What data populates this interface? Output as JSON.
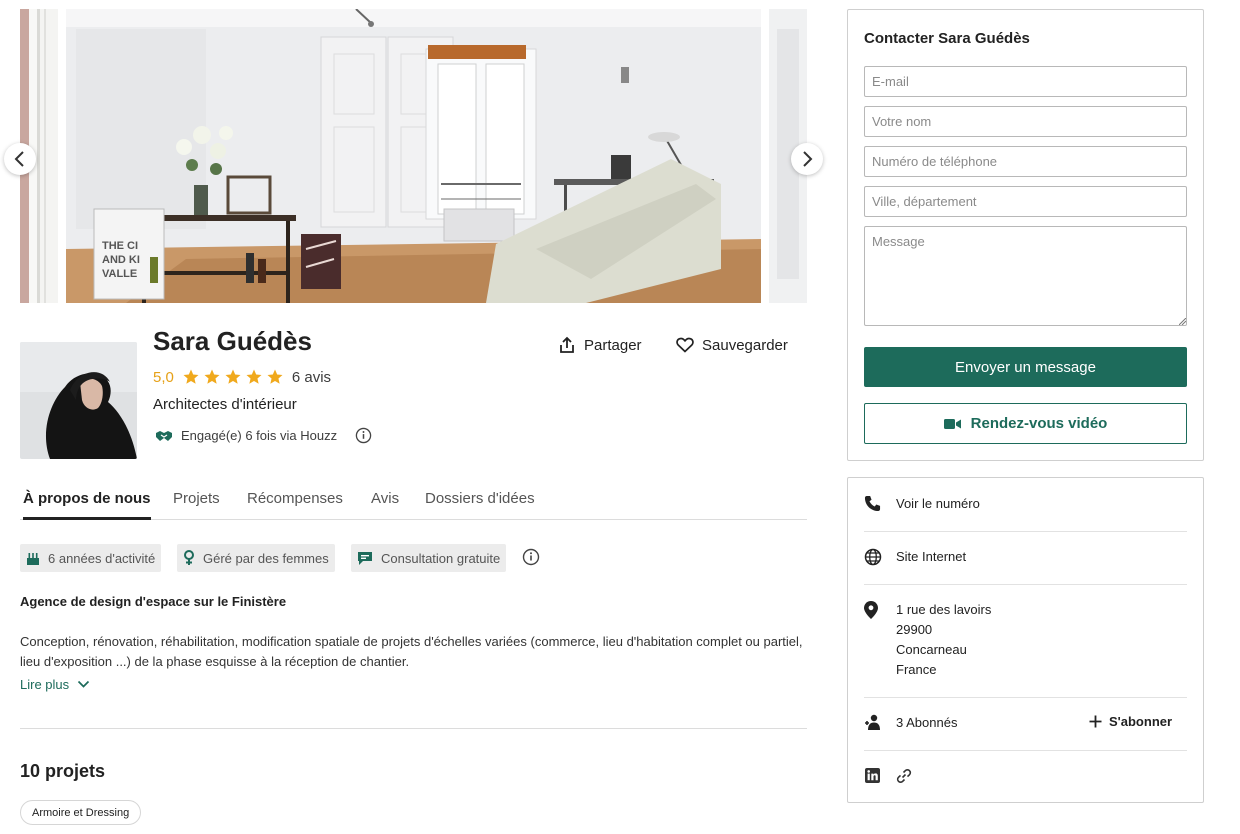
{
  "gallery": {
    "prev_icon": "chevron-left-icon",
    "next_icon": "chevron-right-icon"
  },
  "profile": {
    "name": "Sara Guédès",
    "rating": "5,0",
    "stars": 5,
    "reviews": "6 avis",
    "category": "Architectes d'intérieur",
    "engaged": "Engagé(e) 6 fois via Houzz",
    "share_label": "Partager",
    "save_label": "Sauvegarder"
  },
  "tabs": [
    {
      "label": "À propos de nous",
      "active": true
    },
    {
      "label": "Projets",
      "active": false
    },
    {
      "label": "Récompenses",
      "active": false
    },
    {
      "label": "Avis",
      "active": false
    },
    {
      "label": "Dossiers d'idées",
      "active": false
    }
  ],
  "badges": [
    {
      "label": "6 années d'activité",
      "icon": "cake-icon"
    },
    {
      "label": "Géré par des femmes",
      "icon": "female-icon"
    },
    {
      "label": "Consultation gratuite",
      "icon": "chat-icon"
    }
  ],
  "about": {
    "title": "Agence de design d'espace sur le Finistère",
    "text": "Conception, rénovation, réhabilitation, modification spatiale de projets d'échelles variées (commerce, lieu d'habitation complet ou partiel, lieu d'exposition ...) de la phase esquisse à la réception de chantier.",
    "read_more": "Lire plus"
  },
  "projects": {
    "title": "10 projets",
    "filters": [
      "Armoire et Dressing"
    ]
  },
  "contact": {
    "title": "Contacter Sara Guédès",
    "email_placeholder": "E-mail",
    "name_placeholder": "Votre nom",
    "phone_placeholder": "Numéro de téléphone",
    "city_placeholder": "Ville, département",
    "message_placeholder": "Message",
    "send_label": "Envoyer un message",
    "video_label": "Rendez-vous vidéo"
  },
  "info": {
    "phone_label": "Voir le numéro",
    "website_label": "Site Internet",
    "address": [
      "1 rue des lavoirs",
      "29900",
      "Concarneau",
      "France"
    ],
    "followers": "3 Abonnés",
    "follow_label": "S'abonner"
  },
  "colors": {
    "accent": "#1d6b5b",
    "star": "#f0a91d",
    "rating_text": "#e6a117"
  }
}
